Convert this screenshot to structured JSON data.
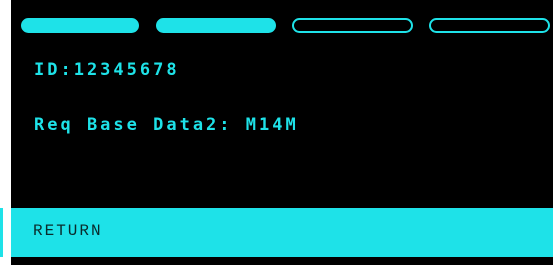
{
  "colors": {
    "accent": "#1ee2e8",
    "background": "#000000",
    "button_text": "#0a2b2c"
  },
  "progress": {
    "steps_total": 4,
    "steps_filled": 2
  },
  "info": {
    "id_text": "ID:12345678",
    "req_text": "Req Base Data2: M14M"
  },
  "actions": {
    "return_label": "RETURN"
  }
}
